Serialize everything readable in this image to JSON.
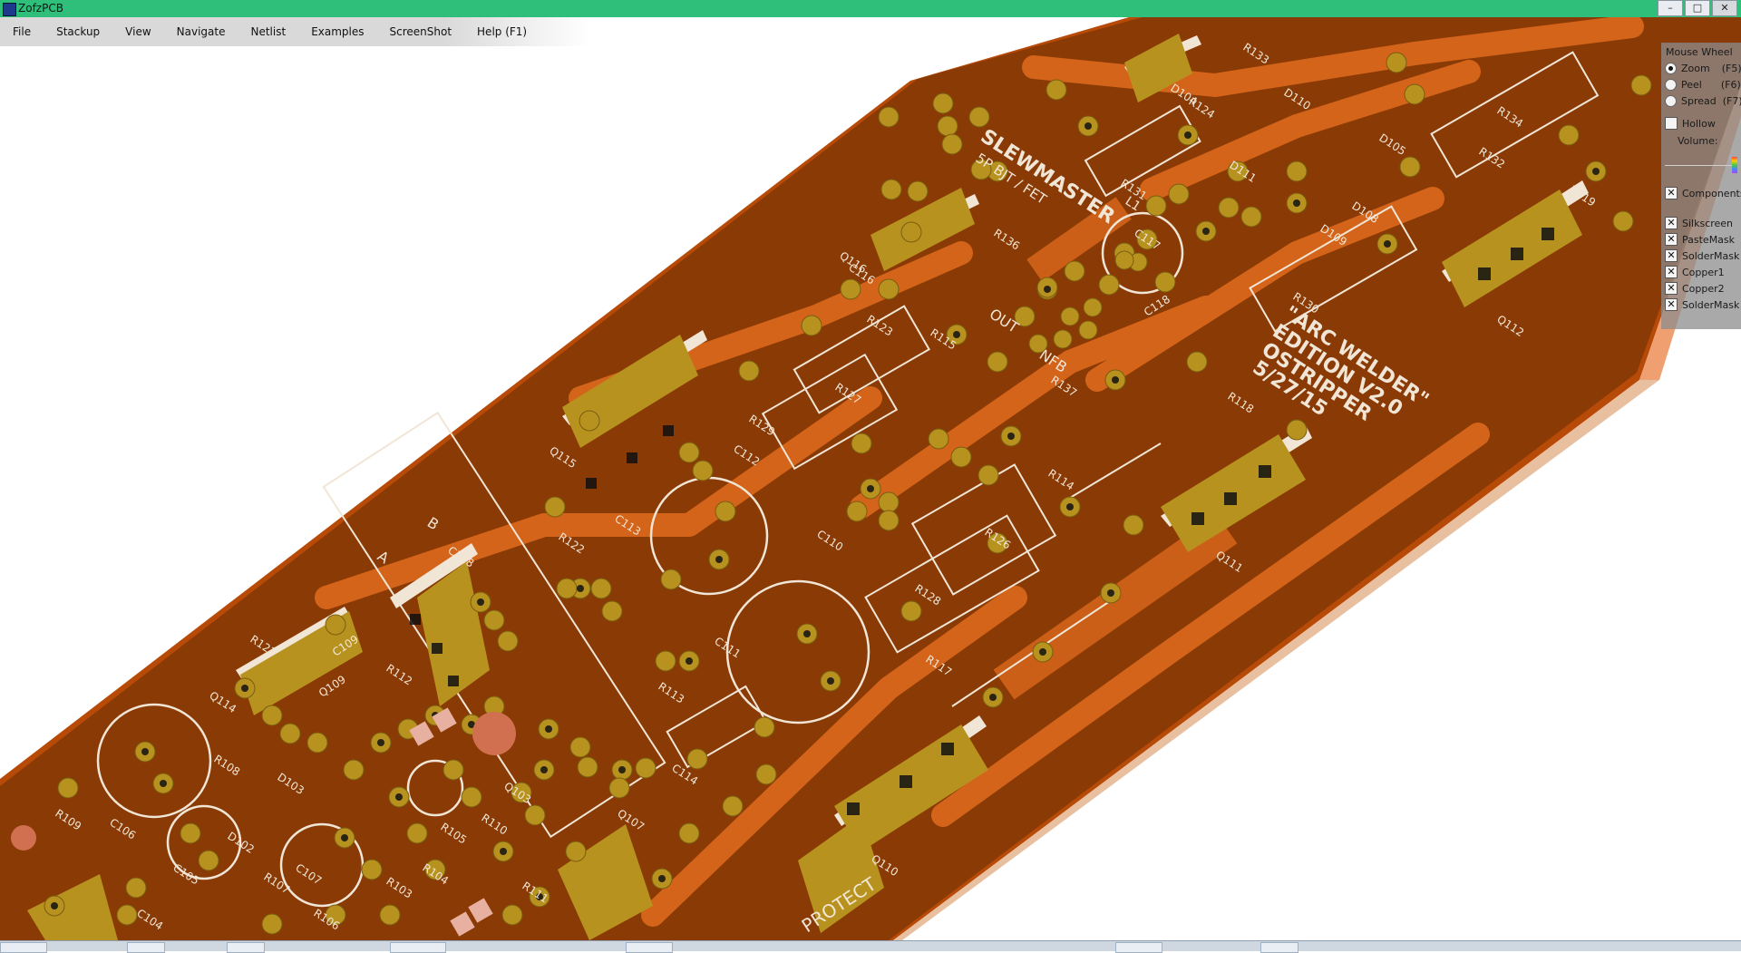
{
  "window": {
    "title": "ZofzPCB"
  },
  "menu": [
    "File",
    "Stackup",
    "View",
    "Navigate",
    "Netlist",
    "Examples",
    "ScreenShot",
    "Help (F1)"
  ],
  "panel": {
    "header": "Mouse Wheel",
    "radios": [
      {
        "label": "Zoom",
        "key": "(F5)",
        "selected": true
      },
      {
        "label": "Peel",
        "key": "(F6)",
        "selected": false
      },
      {
        "label": "Spread",
        "key": "(F7)",
        "selected": false
      }
    ],
    "hollow": {
      "label": "Hollow",
      "checked": false
    },
    "volume_label": "Volume:",
    "layers": [
      {
        "label": "Components",
        "checked": true
      },
      {
        "label": "Silkscreen",
        "checked": true
      },
      {
        "label": "PasteMask",
        "checked": true
      },
      {
        "label": "SolderMask",
        "checked": true
      },
      {
        "label": "Copper1",
        "checked": true
      },
      {
        "label": "Copper2",
        "checked": true
      },
      {
        "label": "SolderMask",
        "checked": true
      }
    ]
  },
  "board": {
    "colors": {
      "substrate": "#8a3a05",
      "copper": "#d3641a",
      "pad": "#b8921f",
      "silk": "#f1e6d6"
    },
    "titles": [
      "SLEWMASTER",
      "5P BJT / FET",
      "\"ARC WELDER\"",
      "EDITION V2.0",
      "OSTRIPPER",
      "5/27/15",
      "PROTECT",
      "OUT",
      "NFB",
      "L1",
      "A",
      "B"
    ],
    "refdes": [
      "R131",
      "R130",
      "R134",
      "R132",
      "R119",
      "R133",
      "D110",
      "D111",
      "D108",
      "D109",
      "Q116",
      "Q112",
      "R136",
      "R123",
      "R115",
      "C118",
      "R118",
      "R137",
      "R127",
      "R129",
      "C112",
      "Q115",
      "R114",
      "C113",
      "R126",
      "Q111",
      "R122",
      "C108",
      "R128",
      "C110",
      "C111",
      "R117",
      "R113",
      "C114",
      "Q110",
      "R121",
      "Q114",
      "Q109",
      "R108",
      "C106",
      "C105",
      "R109",
      "D102",
      "D103",
      "C104",
      "R107",
      "C107",
      "R104",
      "R105",
      "R106",
      "R103",
      "R110",
      "Q103",
      "Q107",
      "R111",
      "D104",
      "D105",
      "C109",
      "C116",
      "C117",
      "R124",
      "R112"
    ]
  }
}
